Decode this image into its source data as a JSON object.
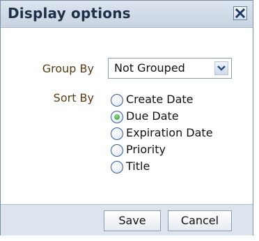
{
  "dialog": {
    "title": "Display options",
    "close_icon": "close-icon"
  },
  "group_by": {
    "label": "Group By",
    "selected": "Not Grouped",
    "arrow_icon": "chevron-down-icon"
  },
  "sort_by": {
    "label": "Sort By",
    "options": [
      {
        "label": "Create Date",
        "checked": false
      },
      {
        "label": "Due Date",
        "checked": true
      },
      {
        "label": "Expiration Date",
        "checked": false
      },
      {
        "label": "Priority",
        "checked": false
      },
      {
        "label": "Title",
        "checked": false
      }
    ]
  },
  "footer": {
    "save_label": "Save",
    "cancel_label": "Cancel"
  },
  "colors": {
    "title_text": "#1f2f48",
    "label_text": "#5a3a12",
    "titlebar_bg": "#c9d4e2",
    "footer_bg": "#dde4ee",
    "radio_selected": "#2f9a2a"
  }
}
